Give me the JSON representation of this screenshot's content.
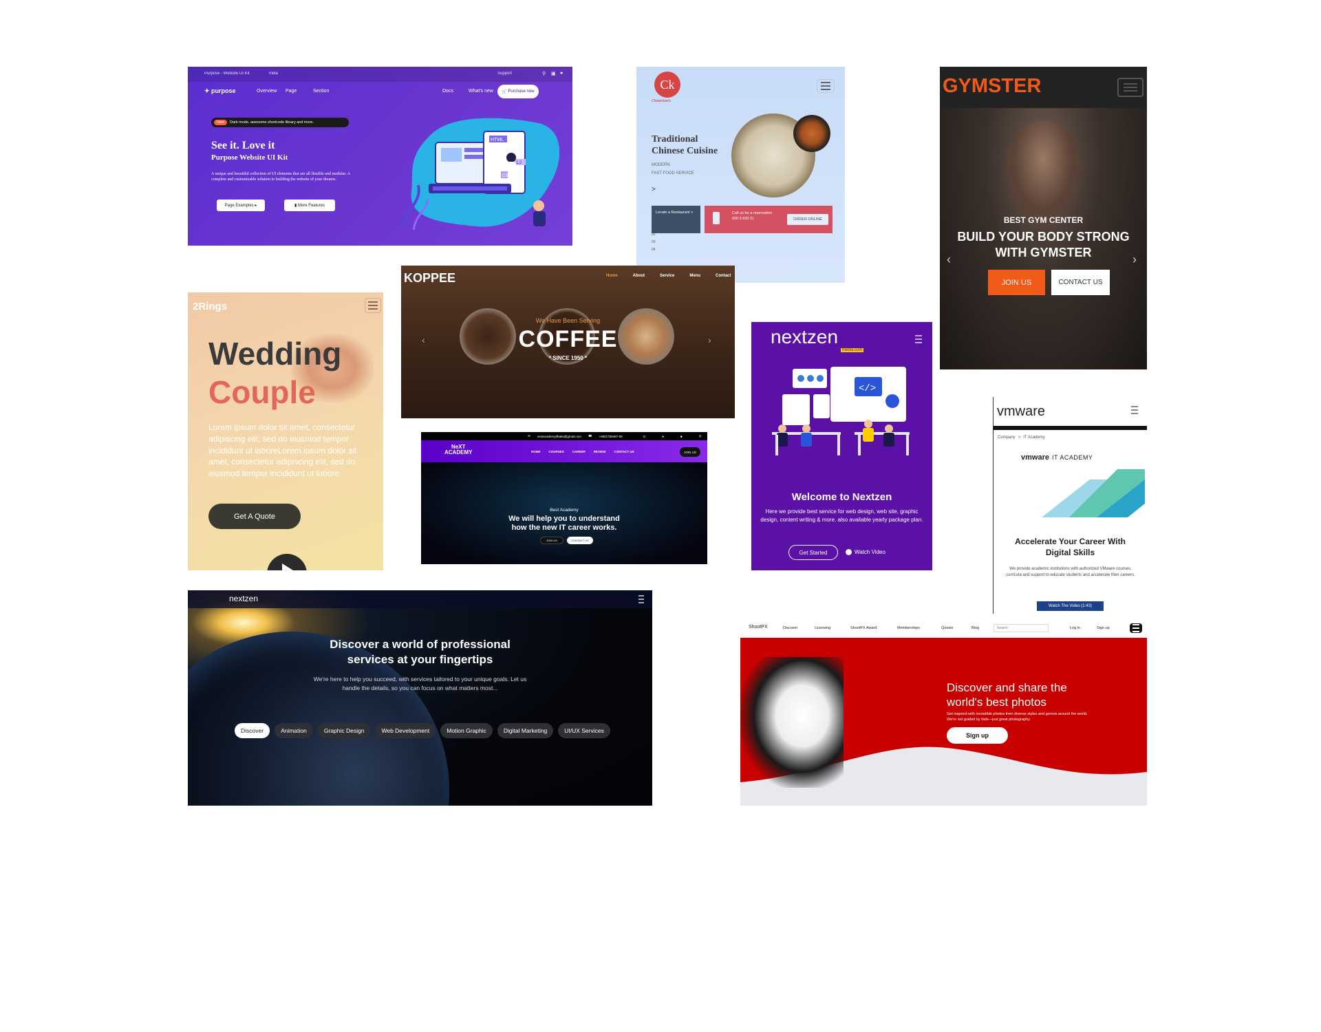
{
  "purpose": {
    "topbar_title": "Purpose - Website UI Kit",
    "topbar_location": "India",
    "topbar_support": "Support",
    "brand": "purpose",
    "nav": [
      "Overview",
      "Page",
      "Section"
    ],
    "nav_right": [
      "Docs",
      "What's new"
    ],
    "purchase_label": "Purchase now",
    "badge_new": "New",
    "badge_text": "Dark mode, awesome shortcode library and more.",
    "title_line1": "See it. Love it",
    "title_line2": "Purpose Website UI Kit",
    "description": "A unique and beautiful collection of UI elements that are all flexible and modular. A complete and customizable solution to building the website of your dreams.",
    "btn_examples": "Page Examples",
    "btn_features": "More Features",
    "illus_html": "HTML",
    "illus_css": "CSS",
    "illus_num": "1.2",
    "colors": {
      "accent": "#5b2ed1",
      "blob": "#2ab4e6"
    }
  },
  "chinese": {
    "logo_text": "Ck",
    "logo_sub": "Chowchow's",
    "title_line1": "Traditional",
    "title_line2": "Chinese Cuisine",
    "sub1": "MODERN",
    "sub2": "FAST FOOD SERVICE",
    "arrow": ">",
    "locate_label": "Locate a Restaurant",
    "locate_arrow": ">",
    "call_label": "Call us for a reservation",
    "call_number": "600 5 600 21",
    "order_label": "ORDER ONLINE",
    "pager": [
      "01",
      "02",
      "03",
      "04"
    ]
  },
  "gym": {
    "brand": "GYMSTER",
    "subtitle": "BEST GYM CENTER",
    "headline_line1": "BUILD YOUR BODY STRONG",
    "headline_line2": "WITH GYMSTER",
    "join_label": "JOIN US",
    "contact_label": "CONTACT US",
    "prev": "‹",
    "next": "›",
    "colors": {
      "accent": "#f25a1a"
    }
  },
  "wedding": {
    "brand": "2Rings",
    "title_line1": "Wedding",
    "title_line2": "Couple",
    "body": "Lorem ipsum dolor sit amet, consectetur adipiscing elit, sed do eiusmod tempor incididunt ut laboreLorem ipsum dolor sit amet, consectetur adipiscing elit, sed do eiusmod tempor incididunt ut labore",
    "cta_label": "Get A Quote",
    "colors": {
      "accent": "#e0675a"
    }
  },
  "koppee": {
    "brand": "KOPPEE",
    "nav": [
      "Home",
      "About",
      "Service",
      "Menu",
      "Contact"
    ],
    "tagline": "We Have Been Serving",
    "title": "COFFEE",
    "since": "* SINCE 1950 *",
    "prev": "‹",
    "next": "›",
    "colors": {
      "accent": "#e39b41"
    }
  },
  "next_academy": {
    "contact_email": "nextacademydhaka@gmail.com",
    "contact_phone": "+8801788487-09",
    "brand_line1": "NeXT",
    "brand_line2": "ACADEMY",
    "nav": [
      "HOME",
      "COURSES",
      "CAREER",
      "REVIEW",
      "CONTACT US"
    ],
    "join_label": "JOIN US",
    "eyebrow": "Best Academy",
    "headline_line1": "We will help you to understand",
    "headline_line2": "how the new IT career works.",
    "btn_join": "JOIN US",
    "btn_contact": "CONTACT US"
  },
  "nextzen_vertical": {
    "brand": "nextzen",
    "brand_sub": "media.com",
    "code_symbol": "</>",
    "title": "Welcome to Nextzen",
    "description": "Here we provide best service for web design, web site, graphic design, content writing & more. also available yearly package plan.",
    "btn_start": "Get Started",
    "btn_video": "Watch Video",
    "colors": {
      "bg": "#5b11a6",
      "accent": "#ffcc00"
    }
  },
  "vmware": {
    "brand": "vmware",
    "breadcrumb_1": "Company",
    "breadcrumb_sep": ">",
    "breadcrumb_2": "IT Academy",
    "logo_brand": "vmware",
    "logo_product": "IT ACADEMY",
    "title_line1": "Accelerate Your Career With",
    "title_line2": "Digital Skills",
    "description": "We provide academic institutions with authorized VMware courses, curricula and support to educate students and accelerate their careers.",
    "video_label": "Watch The Video (1:43)",
    "colors": {
      "button": "#1d428a"
    }
  },
  "nextzen_earth": {
    "brand": "nextzen",
    "title_line1": "Discover a world of professional",
    "title_line2": "services at your fingertips",
    "description": "We're here to help you succeed, with services tailored to your unique goals. Let us handle the details, so you can focus on what matters most...",
    "pills": [
      "Discover",
      "Animation",
      "Graphic Design",
      "Web Development",
      "Motion Graphic",
      "Digital Marketing",
      "UI/UX Services"
    ]
  },
  "shootpx": {
    "brand": "ShootPX",
    "nav": [
      "Discover",
      "Licensing",
      "ShootPX Award",
      "Memberships",
      "Quests",
      "Blog"
    ],
    "search_placeholder": "Search",
    "login_label": "Log in",
    "signup_label": "Sign up",
    "headline_line1": "Discover and share the",
    "headline_line2": "world's best photos",
    "description": "Get inspired with incredible photos from diverse styles and genres around the world. We're not guided by fads—just great photography.",
    "cta_label": "Sign up",
    "colors": {
      "hero": "#c90000"
    }
  }
}
